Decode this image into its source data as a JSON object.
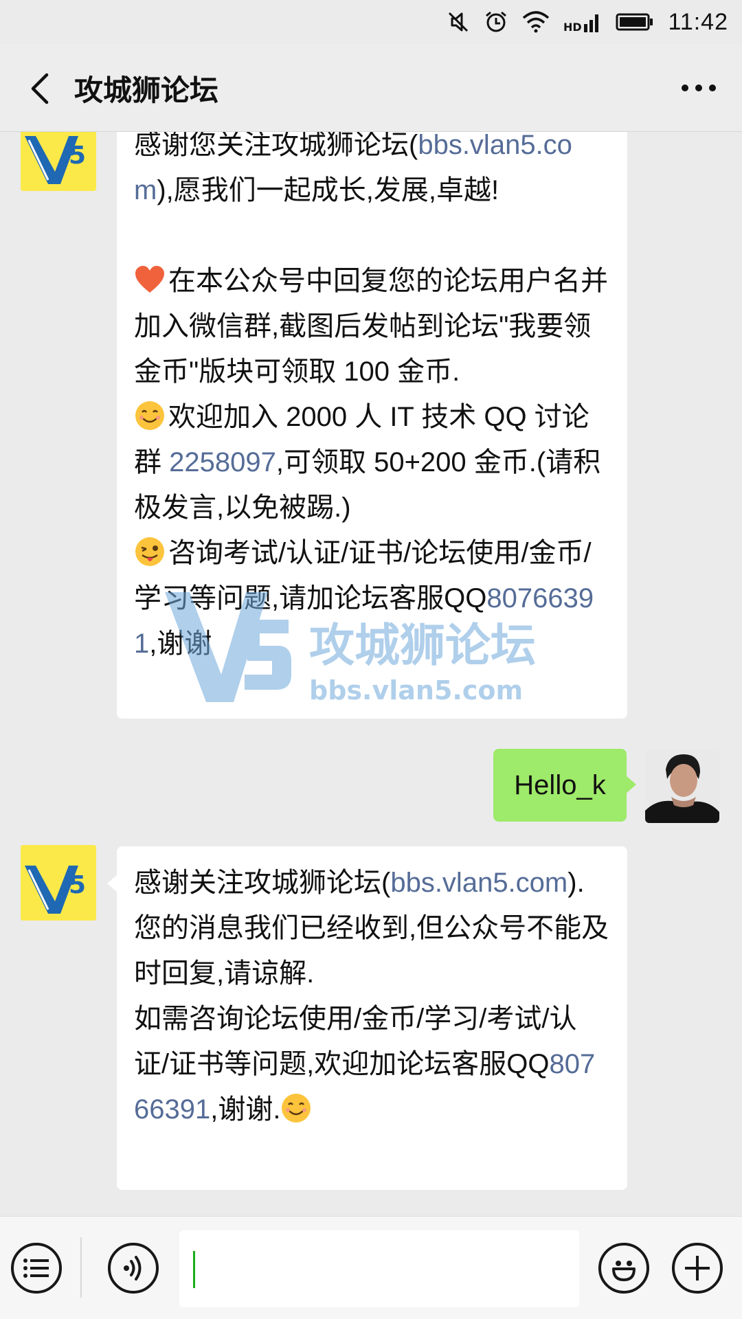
{
  "status_bar": {
    "time": "11:42",
    "icons": [
      "mute-icon",
      "alarm-icon",
      "wifi-icon",
      "hd-signal-icon",
      "battery-icon"
    ]
  },
  "header": {
    "title": "攻城狮论坛",
    "back_icon": "chevron-left-icon",
    "more_icon": "more-icon"
  },
  "messages": [
    {
      "direction": "incoming",
      "sender_avatar": "V5",
      "paragraphs": [
        {
          "parts": [
            {
              "text": "感谢您关注攻城狮论坛("
            },
            {
              "text": "bbs.vlan5.com",
              "link": true
            },
            {
              "text": "),愿我们一起成长,发展,卓越!"
            }
          ]
        },
        {
          "emoji": "heart-icon",
          "parts": [
            {
              "text": "在本公众号中回复您的论坛用户名并加入微信群,截图后发帖到论坛\"我要领金币\"版块可领取 100 金币."
            }
          ]
        },
        {
          "emoji": "smile-icon",
          "parts": [
            {
              "text": "欢迎加入 2000 人 IT 技术 QQ 讨论群 "
            },
            {
              "text": "2258097",
              "link": true
            },
            {
              "text": ",可领取 50+200 金币.(请积极发言,以免被踢.)"
            }
          ]
        },
        {
          "emoji": "wink-tongue-icon",
          "parts": [
            {
              "text": "咨询考试/认证/证书/论坛使用/金币/学习等问题,请加论坛客服QQ"
            },
            {
              "text": "80766391",
              "link": true
            },
            {
              "text": ",谢谢"
            }
          ]
        }
      ]
    },
    {
      "direction": "outgoing",
      "text": "Hello_k"
    },
    {
      "direction": "incoming",
      "sender_avatar": "V5",
      "paragraphs": [
        {
          "parts": [
            {
              "text": "感谢关注攻城狮论坛("
            },
            {
              "text": "bbs.vlan5.com",
              "link": true
            },
            {
              "text": ")."
            }
          ]
        },
        {
          "parts": [
            {
              "text": "您的消息我们已经收到,但公众号不能及时回复,请谅解."
            }
          ]
        },
        {
          "parts": [
            {
              "text": "如需咨询论坛使用/金币/学习/考试/认证/证书等问题,欢迎加论坛客服QQ"
            },
            {
              "text": "80766391",
              "link": true
            },
            {
              "text": ",谢谢."
            }
          ],
          "emoji_end": "smile-icon"
        }
      ]
    }
  ],
  "watermark": {
    "logo": "V5",
    "title": "攻城狮论坛",
    "url": "bbs.vlan5.com"
  },
  "input_bar": {
    "menu_icon": "menu-list-icon",
    "voice_icon": "voice-icon",
    "emoji_icon": "emoji-icon",
    "plus_icon": "plus-icon",
    "value": ""
  },
  "colors": {
    "background": "#ebebeb",
    "incoming_bubble": "#ffffff",
    "outgoing_bubble": "#9eea6a",
    "link": "#556c97",
    "avatar_v5": "#fbe94a",
    "caret": "#1aad19"
  }
}
